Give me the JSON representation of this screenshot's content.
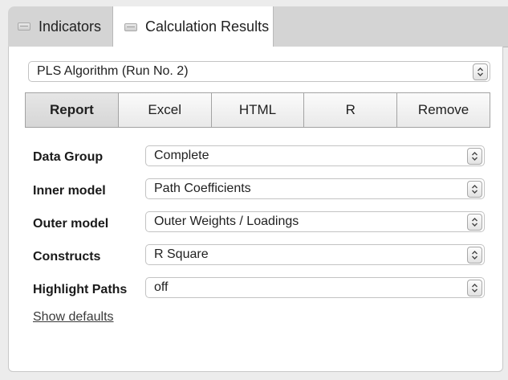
{
  "tabs": [
    {
      "label": "Indicators",
      "active": false
    },
    {
      "label": "Calculation Results",
      "active": true
    }
  ],
  "run_select": {
    "value": "PLS Algorithm (Run No. 2)"
  },
  "buttons": [
    {
      "label": "Report",
      "active": true
    },
    {
      "label": "Excel",
      "active": false
    },
    {
      "label": "HTML",
      "active": false
    },
    {
      "label": "R",
      "active": false
    },
    {
      "label": "Remove",
      "active": false
    }
  ],
  "params": [
    {
      "label": "Data Group",
      "value": "Complete"
    },
    {
      "label": "Inner model",
      "value": "Path Coefficients"
    },
    {
      "label": "Outer model",
      "value": "Outer Weights / Loadings"
    },
    {
      "label": "Constructs",
      "value": "R Square"
    },
    {
      "label": "Highlight Paths",
      "value": "off"
    }
  ],
  "show_defaults": "Show defaults",
  "icons": {
    "tab": "window-icon",
    "stepper": "stepper-icon"
  }
}
